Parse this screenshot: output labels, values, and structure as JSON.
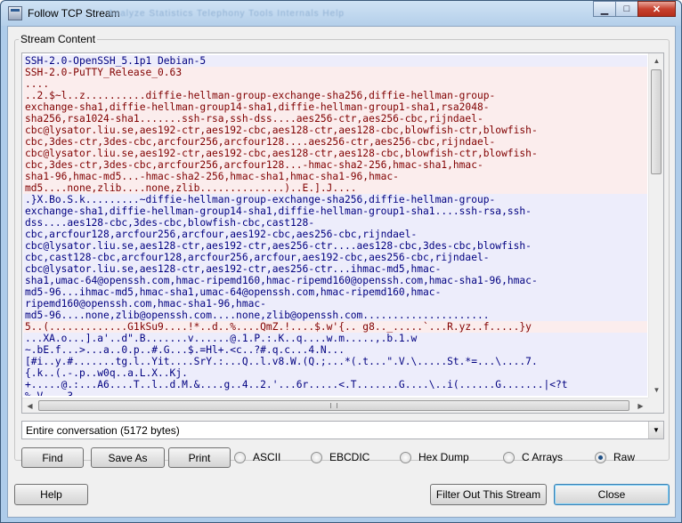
{
  "window": {
    "title": "Follow TCP Stream",
    "ghost_menu": "Analyze   Statistics   Telephony   Tools   Internals   Help",
    "minimize_glyph": "▁",
    "maximize_glyph": "□",
    "close_glyph": "✕"
  },
  "stream": {
    "group_label": "Stream Content",
    "lines": [
      {
        "text": "SSH-2.0-OpenSSH_5.1p1 Debian-5",
        "dir": "server"
      },
      {
        "text": "SSH-2.0-PuTTY_Release_0.63",
        "dir": "client"
      },
      {
        "text": "....",
        "dir": "client"
      },
      {
        "text": "..2.$~l..z..........diffie-hellman-group-exchange-sha256,diffie-hellman-group-",
        "dir": "client"
      },
      {
        "text": "exchange-sha1,diffie-hellman-group14-sha1,diffie-hellman-group1-sha1,rsa2048-",
        "dir": "client"
      },
      {
        "text": "sha256,rsa1024-sha1.......ssh-rsa,ssh-dss....aes256-ctr,aes256-cbc,rijndael-",
        "dir": "client"
      },
      {
        "text": "cbc@lysator.liu.se,aes192-ctr,aes192-cbc,aes128-ctr,aes128-cbc,blowfish-ctr,blowfish-",
        "dir": "client"
      },
      {
        "text": "cbc,3des-ctr,3des-cbc,arcfour256,arcfour128....aes256-ctr,aes256-cbc,rijndael-",
        "dir": "client"
      },
      {
        "text": "cbc@lysator.liu.se,aes192-ctr,aes192-cbc,aes128-ctr,aes128-cbc,blowfish-ctr,blowfish-",
        "dir": "client"
      },
      {
        "text": "cbc,3des-ctr,3des-cbc,arcfour256,arcfour128...-hmac-sha2-256,hmac-sha1,hmac-",
        "dir": "client"
      },
      {
        "text": "sha1-96,hmac-md5...-hmac-sha2-256,hmac-sha1,hmac-sha1-96,hmac-",
        "dir": "client"
      },
      {
        "text": "md5....none,zlib....none,zlib..............)..E.].J....",
        "dir": "client"
      },
      {
        "text": ".}X.Bo.S.k.........~diffie-hellman-group-exchange-sha256,diffie-hellman-group-",
        "dir": "server"
      },
      {
        "text": "exchange-sha1,diffie-hellman-group14-sha1,diffie-hellman-group1-sha1....ssh-rsa,ssh-",
        "dir": "server"
      },
      {
        "text": "dss....aes128-cbc,3des-cbc,blowfish-cbc,cast128-",
        "dir": "server"
      },
      {
        "text": "cbc,arcfour128,arcfour256,arcfour,aes192-cbc,aes256-cbc,rijndael-",
        "dir": "server"
      },
      {
        "text": "cbc@lysator.liu.se,aes128-ctr,aes192-ctr,aes256-ctr....aes128-cbc,3des-cbc,blowfish-",
        "dir": "server"
      },
      {
        "text": "cbc,cast128-cbc,arcfour128,arcfour256,arcfour,aes192-cbc,aes256-cbc,rijndael-",
        "dir": "server"
      },
      {
        "text": "cbc@lysator.liu.se,aes128-ctr,aes192-ctr,aes256-ctr...ihmac-md5,hmac-",
        "dir": "server"
      },
      {
        "text": "sha1,umac-64@openssh.com,hmac-ripemd160,hmac-ripemd160@openssh.com,hmac-sha1-96,hmac-",
        "dir": "server"
      },
      {
        "text": "md5-96...ihmac-md5,hmac-sha1,umac-64@openssh.com,hmac-ripemd160,hmac-",
        "dir": "server"
      },
      {
        "text": "ripemd160@openssh.com,hmac-sha1-96,hmac-",
        "dir": "server"
      },
      {
        "text": "md5-96....none,zlib@openssh.com....none,zlib@openssh.com.....................",
        "dir": "server"
      },
      {
        "text": "5..(.............G1kSu9....!*..d..%....QmZ.!....$.w'{.. g8.._.....`...R.yz..f.....}y",
        "dir": "client"
      },
      {
        "text": "...XA.o...].a'..d\".B.......v......@.1.P.:.K..q....w.m.....,.b.1.w",
        "dir": "server"
      },
      {
        "text": "~.bE.f...>...a..0.p..#.G...$.=Hl+.<c..?#.q.c...4.N...",
        "dir": "server"
      },
      {
        "text": "[#i..y.#.......tg.l..Yit....SrY.:...Q..l.v8.W.(Q.;...*(.t...\".V.\\.....St.*=...\\....7.",
        "dir": "server"
      },
      {
        "text": "{.k..(.-.p..w0q..a.L.X..Kj.",
        "dir": "server"
      },
      {
        "text": "+.....@.:...A6....T..l..d.M.&....g..4..2.'...6r.....<.T.......G....\\..i(......G.......|<?t",
        "dir": "server"
      },
      {
        "text": "%.V....3",
        "dir": "server"
      }
    ]
  },
  "conversation_select": {
    "value": "Entire conversation (5172 bytes)"
  },
  "buttons": {
    "find": "Find",
    "save_as": "Save As",
    "print": "Print",
    "help": "Help",
    "filter_out": "Filter Out This Stream",
    "close": "Close"
  },
  "format_options": [
    {
      "label": "ASCII",
      "checked": false
    },
    {
      "label": "EBCDIC",
      "checked": false
    },
    {
      "label": "Hex Dump",
      "checked": false
    },
    {
      "label": "C Arrays",
      "checked": false
    },
    {
      "label": "Raw",
      "checked": true
    }
  ],
  "colors": {
    "client_text": "#800000",
    "client_bg": "#fbeded",
    "server_text": "#000080",
    "server_bg": "#ededfb"
  }
}
